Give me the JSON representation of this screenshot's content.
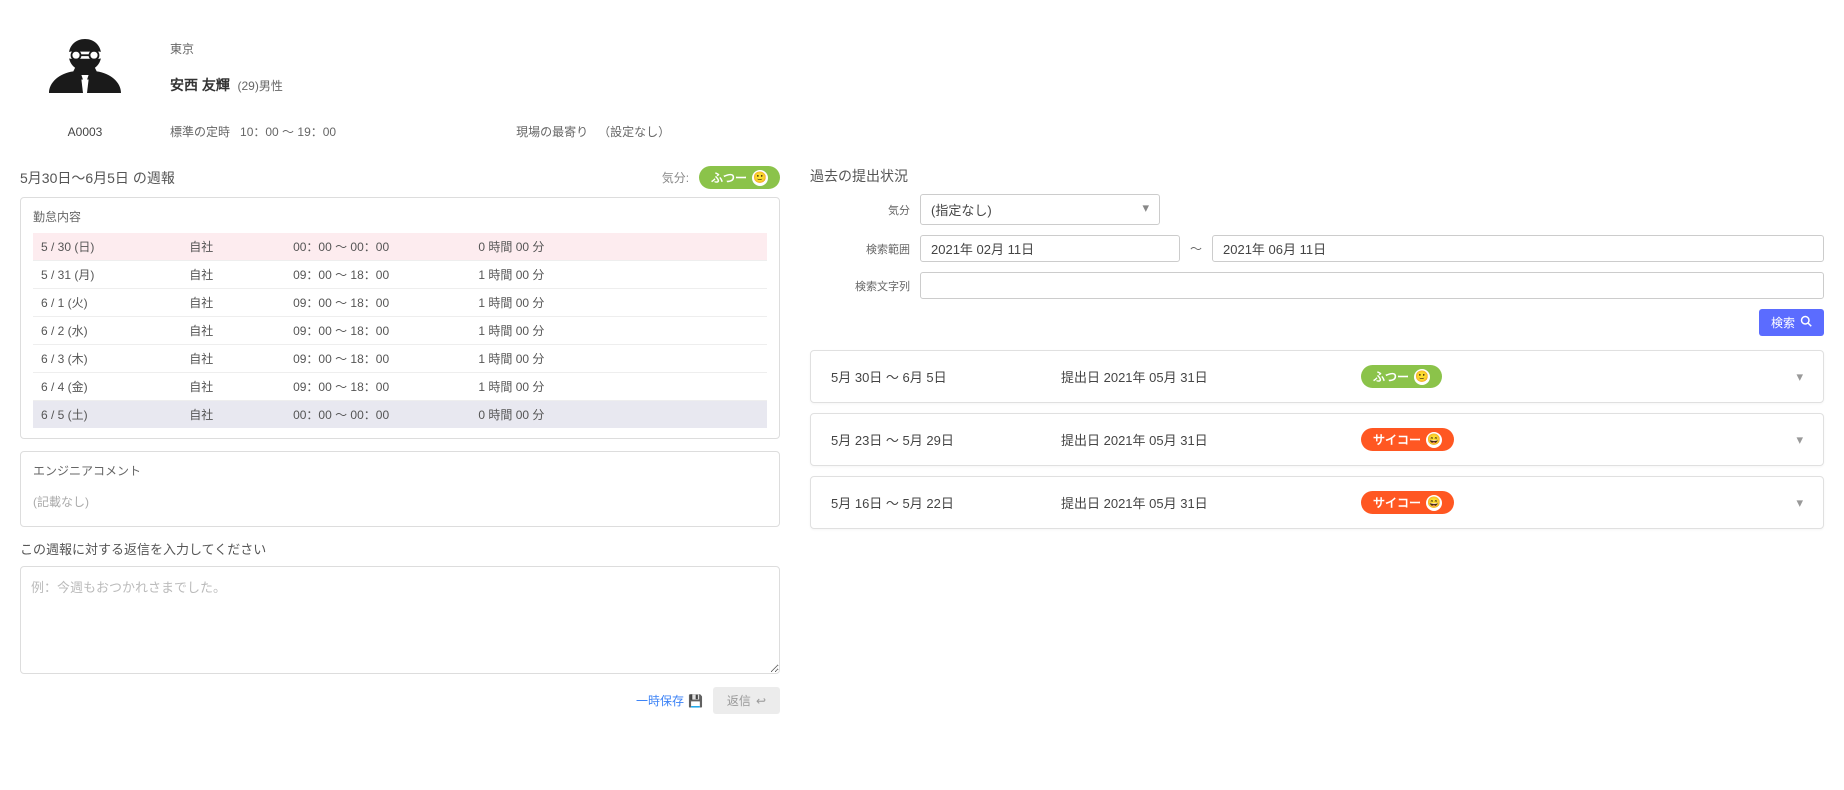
{
  "profile": {
    "id": "A0003",
    "location": "東京",
    "name": "安西 友輝",
    "age_gender": "(29)男性",
    "std_hours_label": "標準の定時",
    "std_hours": "10：00 ～ 19：00",
    "nearest_label": "現場の最寄り",
    "nearest_value": "（設定なし）"
  },
  "report": {
    "title": "5月30日～6月5日 の週報",
    "mood_label": "気分:",
    "mood_text": "ふつー",
    "attendance_title": "勤怠内容",
    "rows": [
      {
        "date": "5 / 30 (日)",
        "loc": "自社",
        "time": "00：00 ～ 00：00",
        "dur": "0 時間 00 分",
        "cls": "row-pink"
      },
      {
        "date": "5 / 31 (月)",
        "loc": "自社",
        "time": "09：00 ～ 18：00",
        "dur": "1 時間 00 分",
        "cls": ""
      },
      {
        "date": "6 / 1 (火)",
        "loc": "自社",
        "time": "09：00 ～ 18：00",
        "dur": "1 時間 00 分",
        "cls": ""
      },
      {
        "date": "6 / 2 (水)",
        "loc": "自社",
        "time": "09：00 ～ 18：00",
        "dur": "1 時間 00 分",
        "cls": ""
      },
      {
        "date": "6 / 3 (木)",
        "loc": "自社",
        "time": "09：00 ～ 18：00",
        "dur": "1 時間 00 分",
        "cls": ""
      },
      {
        "date": "6 / 4 (金)",
        "loc": "自社",
        "time": "09：00 ～ 18：00",
        "dur": "1 時間 00 分",
        "cls": ""
      },
      {
        "date": "6 / 5 (土)",
        "loc": "自社",
        "time": "00：00 ～ 00：00",
        "dur": "0 時間 00 分",
        "cls": "row-grey"
      }
    ],
    "comment_title": "エンジニアコメント",
    "comment_empty": "(記載なし)"
  },
  "reply": {
    "label": "この週報に対する返信を入力してください",
    "placeholder": "例：今週もおつかれさまでした。",
    "draft_label": "一時保存",
    "send_label": "返信"
  },
  "history": {
    "title": "過去の提出状況",
    "filter_mood_label": "気分",
    "filter_mood_value": "(指定なし)",
    "filter_range_label": "検索範囲",
    "filter_from": "2021年 02月 11日",
    "filter_to": "2021年 06月 11日",
    "filter_tilde": "～",
    "filter_text_label": "検索文字列",
    "search_label": "検索",
    "items": [
      {
        "range": "5月 30日 ～ 6月 5日",
        "sub": "提出日 2021年 05月 31日",
        "mood": "ふつー",
        "color": "green"
      },
      {
        "range": "5月 23日 ～ 5月 29日",
        "sub": "提出日 2021年 05月 31日",
        "mood": "サイコー",
        "color": "red"
      },
      {
        "range": "5月 16日 ～ 5月 22日",
        "sub": "提出日 2021年 05月 31日",
        "mood": "サイコー",
        "color": "red"
      }
    ]
  }
}
